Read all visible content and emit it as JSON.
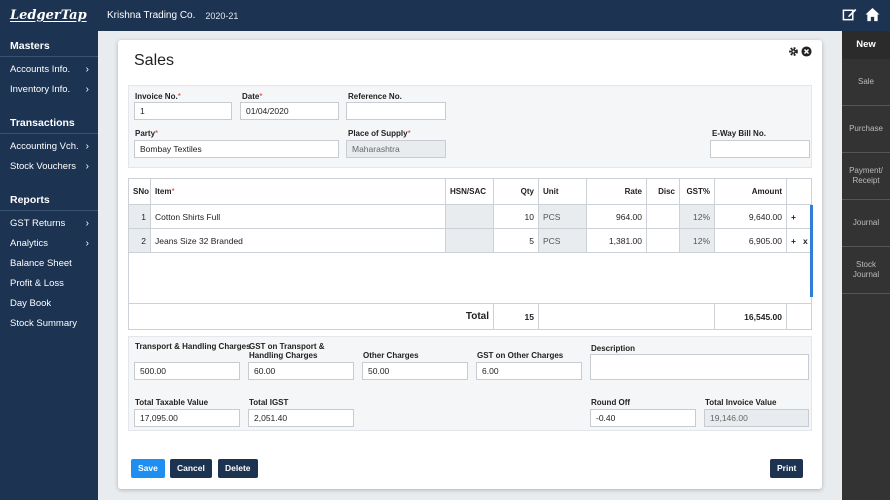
{
  "app": {
    "logo": "LedgerTap",
    "company": "Krishna Trading Co.",
    "fy": "2020-21"
  },
  "top_icons": [
    "edit-icon",
    "home-icon"
  ],
  "sidebar": {
    "masters": {
      "title": "Masters",
      "items": [
        "Accounts Info.",
        "Inventory Info."
      ]
    },
    "transactions": {
      "title": "Transactions",
      "items": [
        "Accounting Vch.",
        "Stock Vouchers"
      ]
    },
    "reports": {
      "title": "Reports",
      "items": [
        "GST Returns",
        "Analytics",
        "Balance Sheet",
        "Profit & Loss",
        "Day Book",
        "Stock Summary"
      ]
    },
    "chevron": "›"
  },
  "rightbar": {
    "title": "New",
    "items": [
      "Sale",
      "Purchase",
      "Payment/ Receipt",
      "Journal",
      "Stock Journal"
    ]
  },
  "modal": {
    "title": "Sales",
    "header": {
      "invoice_no_label": "Invoice No.",
      "invoice_no": "1",
      "date_label": "Date",
      "date": "01/04/2020",
      "ref_label": "Reference No.",
      "ref": "",
      "party_label": "Party",
      "party": "Bombay Textiles",
      "pos_label": "Place of Supply",
      "pos": "Maharashtra",
      "eway_label": "E-Way Bill No.",
      "eway": "",
      "required_mark": "*"
    },
    "grid": {
      "columns": [
        "SNo",
        "Item",
        "HSN/SAC",
        "Qty",
        "Unit",
        "Rate",
        "Disc",
        "GST%",
        "Amount"
      ],
      "item_required_mark": "*",
      "rows": [
        {
          "sno": "1",
          "item": "Cotton Shirts Full",
          "hsn": "",
          "qty": "10",
          "unit": "PCS",
          "rate": "964.00",
          "disc": "",
          "gst": "12%",
          "amount": "9,640.00",
          "actions": "+"
        },
        {
          "sno": "2",
          "item": "Jeans Size 32 Branded",
          "hsn": "",
          "qty": "5",
          "unit": "PCS",
          "rate": "1,381.00",
          "disc": "",
          "gst": "12%",
          "amount": "6,905.00",
          "actions": "+   x"
        }
      ],
      "total_label": "Total",
      "total_qty": "15",
      "total_amount": "16,545.00"
    },
    "footer": {
      "transport_label": "Transport & Handling Charges",
      "transport": "500.00",
      "gst_transport_label": "GST on Transport & Handling Charges",
      "gst_transport": "60.00",
      "other_label": "Other Charges",
      "other": "50.00",
      "gst_other_label": "GST on Other Charges",
      "gst_other": "6.00",
      "desc_label": "Description",
      "desc": "",
      "taxable_label": "Total Taxable Value",
      "taxable": "17,095.00",
      "igst_label": "Total IGST",
      "igst": "2,051.40",
      "round_label": "Round Off",
      "round": "-0.40",
      "invoice_value_label": "Total Invoice Value",
      "invoice_value": "19,146.00"
    },
    "buttons": {
      "save": "Save",
      "cancel": "Cancel",
      "delete": "Delete",
      "print": "Print"
    }
  },
  "colors": {
    "navy": "#1c3352",
    "primary": "#1f8ef1",
    "dark_panel": "#333333"
  }
}
